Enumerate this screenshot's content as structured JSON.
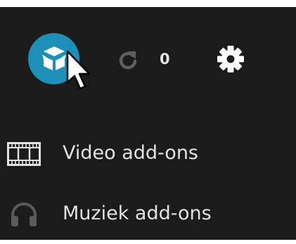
{
  "topbar": {
    "addon_browser_icon": "open-box-icon",
    "update_icon": "refresh-icon",
    "update_count": "0",
    "settings_icon": "gear-icon"
  },
  "menu": {
    "items": [
      {
        "label": "Video add-ons",
        "icon": "film-strip-icon"
      },
      {
        "label": "Muziek add-ons",
        "icon": "headphones-icon"
      }
    ]
  },
  "colors": {
    "background": "#1b1b1b",
    "accent": "#1e8fb8",
    "text": "#e2e2e2"
  }
}
